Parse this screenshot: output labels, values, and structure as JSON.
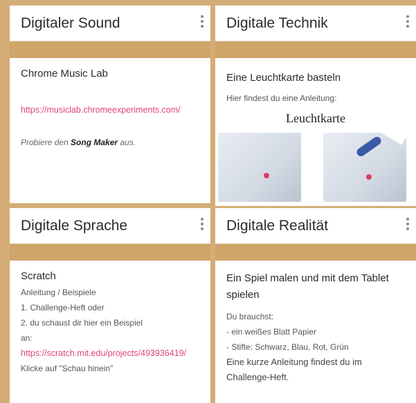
{
  "cards": [
    {
      "title": "Digitaler Sound",
      "heading": "Chrome Music Lab",
      "link": "https://musiclab.chromeexperiments.com/",
      "text_pre": "Probiere den ",
      "text_bold": "Song Maker",
      "text_post": " aus."
    },
    {
      "title": "Digitale Technik",
      "heading": "Eine Leuchtkarte basteln",
      "text": "Hier findest du eine Anleitung:",
      "image_title": "Leuchtkarte"
    },
    {
      "title": "Digitale Sprache",
      "heading": "Scratch",
      "lines": [
        "Anleitung / Beispiele",
        "1. Challenge-Heft oder",
        "2. du schaust dir hier ein Beispiel",
        "an:"
      ],
      "link": "https://scratch.mit.edu/projects/493936419/",
      "after_link": " Klicke auf \"Schau hinein\""
    },
    {
      "title": "Digitale Realität",
      "heading": "Ein Spiel malen und mit dem Tablet spielen",
      "lines": [
        "Du brauchst:",
        "- ein weißes Blatt Papier",
        "- Stifte: Schwarz, Blau, Rot, Grün",
        "Eine kurze Anleitung findest du im",
        "Challenge-Heft."
      ]
    }
  ],
  "colors": {
    "background": "#d4ad76",
    "link": "#e0457b"
  },
  "icons": {
    "menu": "more-vertical-icon"
  }
}
